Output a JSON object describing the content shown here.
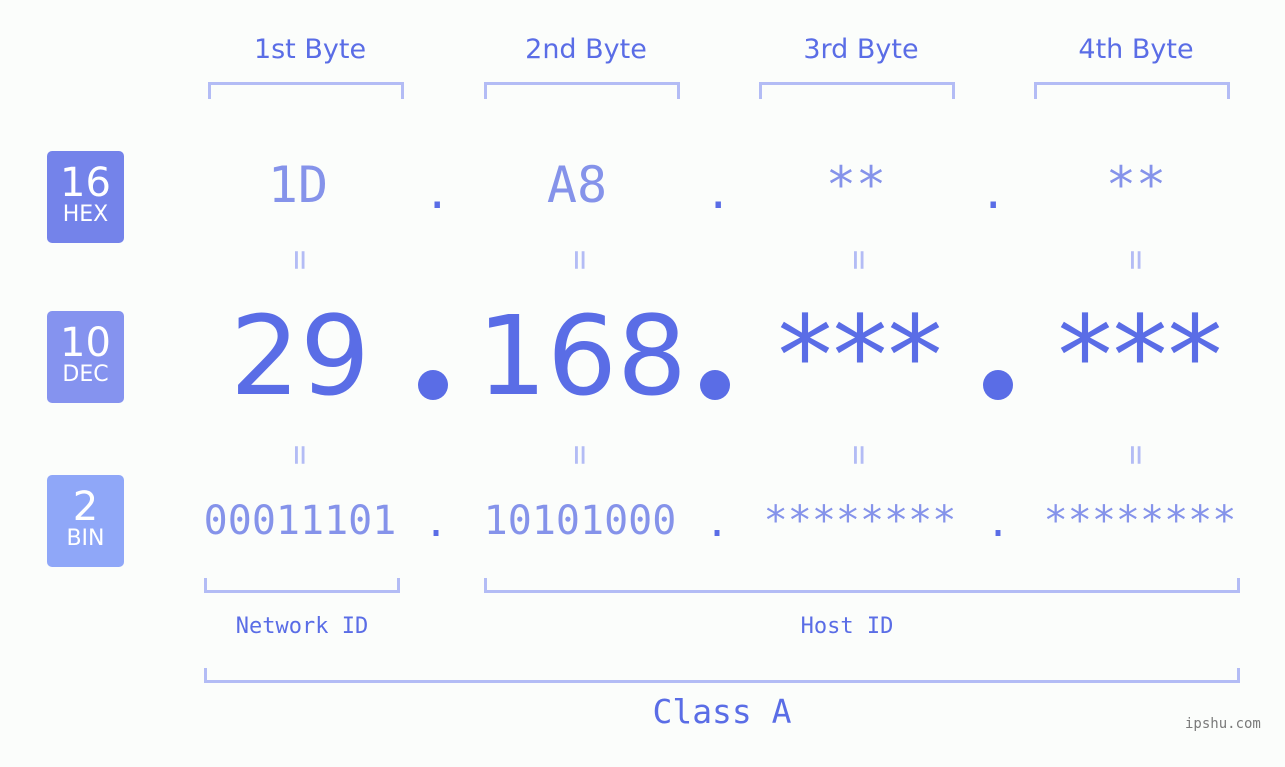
{
  "byte_headers": [
    "1st Byte",
    "2nd Byte",
    "3rd Byte",
    "4th Byte"
  ],
  "bases": [
    {
      "number": "16",
      "label": "HEX",
      "color": "#7483ea"
    },
    {
      "number": "10",
      "label": "DEC",
      "color": "#8593ef"
    },
    {
      "number": "2",
      "label": "BIN",
      "color": "#8fa7f8"
    }
  ],
  "hex": [
    "1D",
    "A8",
    "**",
    "**"
  ],
  "dec": [
    "29",
    "168",
    "***",
    "***"
  ],
  "bin": [
    "00011101",
    "10101000",
    "********",
    "********"
  ],
  "separator": ".",
  "equals": "=",
  "network_id_label": "Network ID",
  "host_id_label": "Host ID",
  "class_label": "Class A",
  "watermark": "ipshu.com",
  "colors": {
    "primary": "#5a6de6",
    "light": "#8593ea",
    "bracket": "#b3bcf5"
  }
}
